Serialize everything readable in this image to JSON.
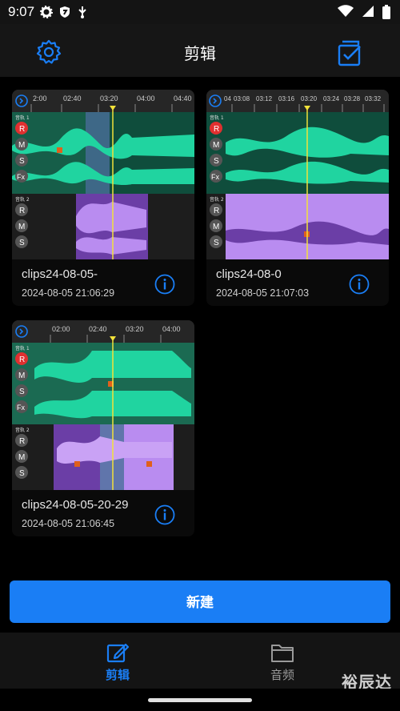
{
  "status_bar": {
    "time": "9:07",
    "left_icons": [
      "gear-icon",
      "shield-icon",
      "usb-icon"
    ],
    "right_icons": [
      "wifi-icon",
      "signal-icon",
      "battery-icon"
    ]
  },
  "header": {
    "title": "剪辑",
    "left_icon": "settings-icon",
    "right_icon": "multi-select-icon",
    "accent": "#1a7ef5"
  },
  "projects": [
    {
      "title": "clips24-08-05-",
      "date": "2024-08-05 21:06:29",
      "timeline_labels": [
        "2:00",
        "02:40",
        "03:20",
        "04:00",
        "04:40"
      ],
      "tracks": [
        "音轨 1",
        "音轨 2"
      ]
    },
    {
      "title": "clips24-08-0",
      "date": "2024-08-05 21:07:03",
      "timeline_labels": [
        "04",
        "03:08",
        "03:12",
        "03:16",
        "03:20",
        "03:24",
        "03:28",
        "03:32"
      ],
      "tracks": [
        "音轨 1",
        "音轨 2"
      ]
    },
    {
      "title": "clips24-08-05-20-29",
      "date": "2024-08-05 21:06:45",
      "timeline_labels": [
        "02:00",
        "02:40",
        "03:20",
        "04:00"
      ],
      "tracks": [
        "音轨 1",
        "音轨 2"
      ]
    }
  ],
  "track_buttons": [
    "R",
    "M",
    "S",
    "Fx"
  ],
  "new_button": "新建",
  "bottom_nav": {
    "items": [
      {
        "label": "剪辑",
        "icon": "edit-icon",
        "active": true
      },
      {
        "label": "音频",
        "icon": "folder-icon",
        "active": false
      }
    ],
    "active_color": "#1a7ef5",
    "inactive_color": "#9a9a9a"
  },
  "watermark": "裕辰达",
  "colors": {
    "wave_green": "#20d4a0",
    "wave_purple": "#b98cf0",
    "playhead": "#f2e23a",
    "record": "#e03030"
  }
}
